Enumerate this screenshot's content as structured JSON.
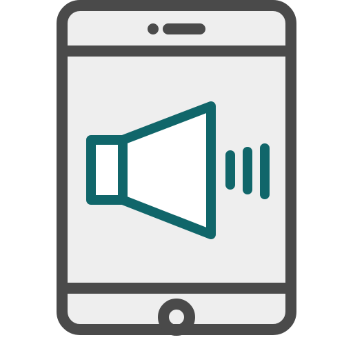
{
  "icon": {
    "name": "phone-speaker-volume-icon",
    "parts": [
      "smartphone-outline",
      "speaker-icon",
      "volume-bars"
    ]
  },
  "colors": {
    "background": "#ffffff",
    "screen_fill": "#eeeeee",
    "phone_stroke": "#4a4a4a",
    "speaker_stroke": "#10666a",
    "speaker_fill": "#ffffff"
  },
  "volume": {
    "bars": 3
  }
}
